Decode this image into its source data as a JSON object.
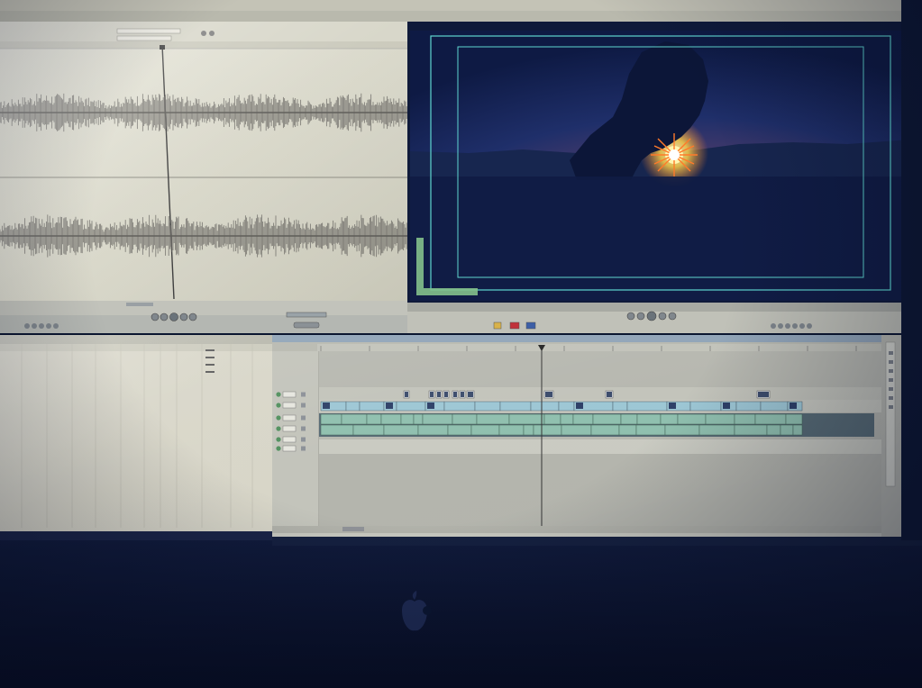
{
  "colors": {
    "background": "#0b1630",
    "panel": "#d4d3c4",
    "waveform": "#6d6b66",
    "canvas": "#0f1a3a",
    "sunset_orange": "#f08a3a",
    "sun_core": "#ffe27a",
    "safe_area": "#5fd6d0",
    "clip_green": "#8fbfae",
    "clip_blue": "#9cc6d4",
    "playhead": "#333333"
  },
  "icons": {
    "apple_logo": "apple-logo-icon",
    "transport_play": "play-icon",
    "transport_controls": "transport-controls-icon"
  },
  "scene": {
    "subject": "silhouette-of-head-against-sunset"
  }
}
